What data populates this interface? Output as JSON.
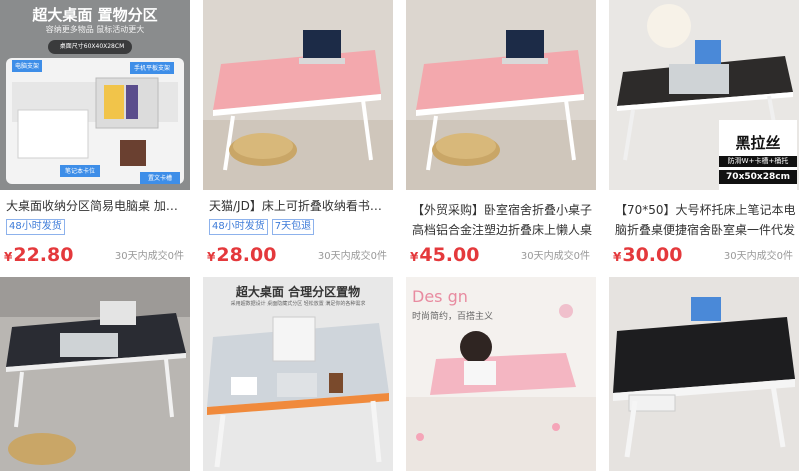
{
  "products": [
    {
      "title": "大桌面收纳分区简易电脑桌 加大加厚",
      "tags": [
        "48小时发货"
      ],
      "price_symbol": "¥",
      "price": "22.80",
      "sold": "30天内成交0件",
      "image_text": {
        "headline": "超大桌面 置物分区",
        "sub": "容纳更多物品 鼠标活动更大",
        "size_badge": "桌面尺寸60X40X28CM",
        "callout_left": "电脑支架",
        "callout_right": "手机平板支架",
        "callout_bottom_left": "笔记本卡位",
        "callout_bottom_right": "置文卡槽"
      }
    },
    {
      "title": "天猫/JD】床上可折叠收纳看书桌笔记本",
      "tags": [
        "48小时发货",
        "7天包退"
      ],
      "price_symbol": "¥",
      "price": "28.00",
      "sold": "30天内成交0件"
    },
    {
      "title": "【外贸采购】卧室宿舍折叠小桌子高档铝合金注塑边折叠床上懒人桌",
      "tags": [],
      "price_symbol": "¥",
      "price": "45.00",
      "sold": "30天内成交0件"
    },
    {
      "title": "【70*50】大号杯托床上笔记本电脑折叠桌便捷宿舍卧室桌一件代发",
      "tags": [],
      "price_symbol": "¥",
      "price": "30.00",
      "sold": "30天内成交0件",
      "image_text": {
        "badge_title": "黑拉丝",
        "badge_feature": "防滑W+卡槽+桶托",
        "badge_size": "70x50x28cm"
      }
    },
    {
      "title": "",
      "tags": [],
      "price": "",
      "sold": ""
    },
    {
      "title": "",
      "tags": [],
      "price": "",
      "sold": "",
      "image_text": {
        "headline": "超大桌面 合理分区置物",
        "sub": "采用超数据设计 桌面隐藏式分区 轻松放置 满足你的各种需求"
      }
    },
    {
      "title": "",
      "tags": [],
      "price": "",
      "sold": "",
      "image_text": {
        "headline": "Des gn",
        "sub": "时尚简约，百搭主义"
      }
    },
    {
      "title": "",
      "tags": [],
      "price": "",
      "sold": ""
    }
  ]
}
